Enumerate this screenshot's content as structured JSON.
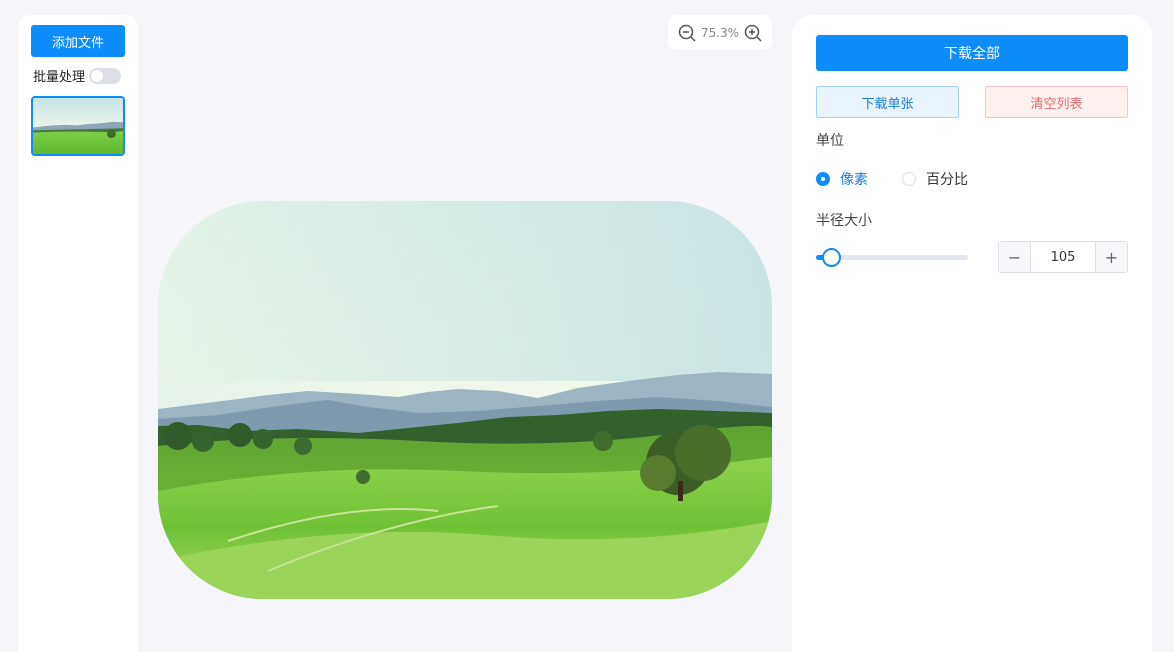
{
  "sidebar": {
    "add_file_label": "添加文件",
    "batch_label": "批量处理",
    "batch_enabled": false
  },
  "zoom": {
    "level": "75.3%",
    "zoom_out_icon": "zoom-out-icon",
    "zoom_in_icon": "zoom-in-icon"
  },
  "panel": {
    "download_all_label": "下载全部",
    "download_one_label": "下载单张",
    "clear_list_label": "清空列表",
    "unit_label": "单位",
    "unit_options": [
      "像素",
      "百分比"
    ],
    "unit_selected": "像素",
    "radius_label": "半径大小",
    "radius_value": "105",
    "radius_slider_fraction": 0.1
  },
  "colors": {
    "primary": "#0d8cfb",
    "danger_text": "#e06c6c"
  }
}
